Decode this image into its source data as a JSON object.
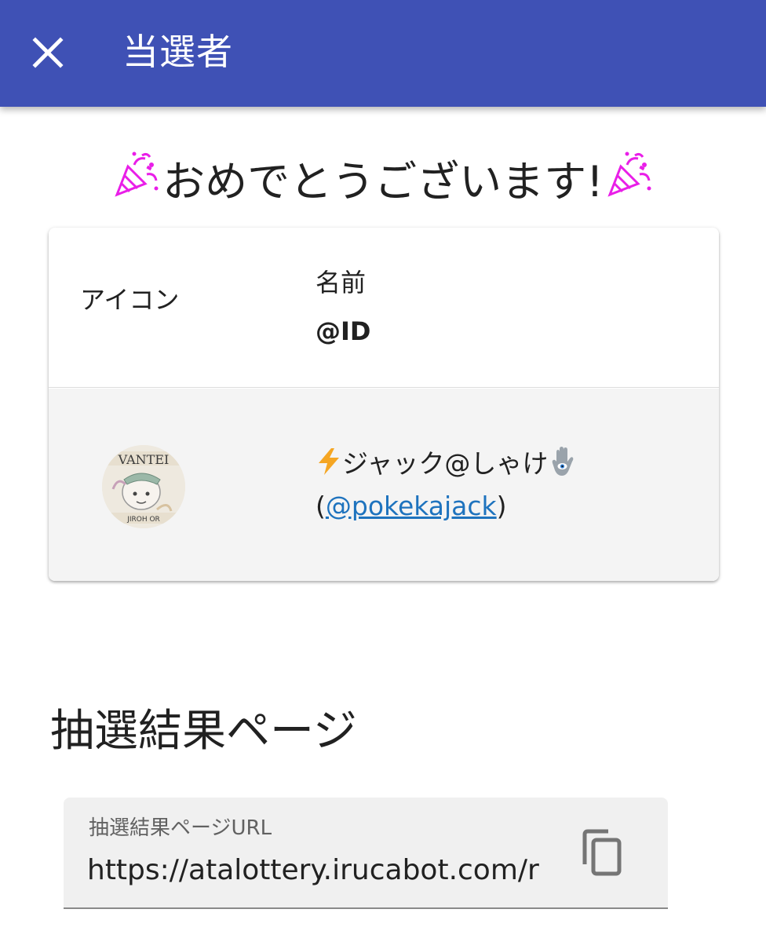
{
  "appbar": {
    "title": "当選者",
    "close_icon": "close-icon",
    "color": "#3f51b5"
  },
  "congrats": {
    "text": "おめでとうございます!",
    "left_icon": "party-popper-icon",
    "right_icon": "party-popper-icon"
  },
  "table": {
    "headers": {
      "icon": "アイコン",
      "name": "名前",
      "id": "@ID"
    },
    "rows": [
      {
        "avatar": "avatar",
        "name_prefix_icon": "lightning-icon",
        "name": "ジャック@しゃけ",
        "name_suffix_icon": "hamsa-icon",
        "id_open": "(",
        "id": "@pokekajack",
        "id_close": ")"
      }
    ]
  },
  "result_section": {
    "title": "抽選結果ページ",
    "url_label": "抽選結果ページURL",
    "url_value": "https://atalottery.irucabot.com/r",
    "copy_icon": "copy-icon"
  },
  "colors": {
    "link": "#1e73be",
    "accent_pink": "#e91e63"
  }
}
